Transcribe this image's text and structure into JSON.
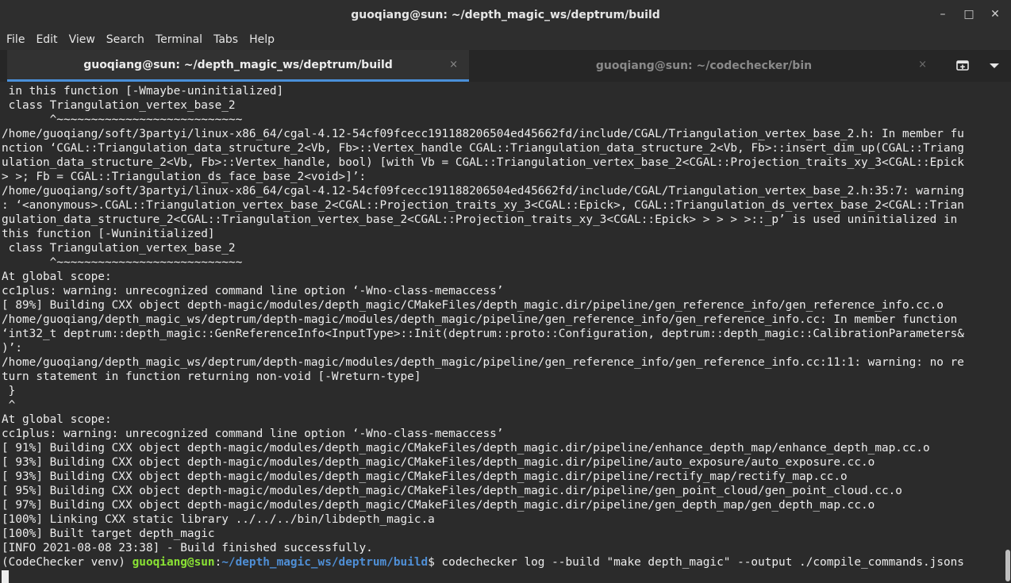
{
  "window": {
    "title": "guoqiang@sun: ~/depth_magic_ws/deptrum/build",
    "minimize": "–",
    "maximize": "□",
    "close": "✕"
  },
  "menu": [
    "File",
    "Edit",
    "View",
    "Search",
    "Terminal",
    "Tabs",
    "Help"
  ],
  "tabs": [
    {
      "label": "guoqiang@sun: ~/depth_magic_ws/deptrum/build",
      "close": "×",
      "active": true
    },
    {
      "label": "guoqiang@sun: ~/codechecker/bin",
      "close": "×",
      "active": false
    }
  ],
  "terminal": {
    "lines": [
      " in this function [-Wmaybe-uninitialized]",
      " class Triangulation_vertex_base_2",
      "       ^~~~~~~~~~~~~~~~~~~~~~~~~~~~",
      "/home/guoqiang/soft/3partyi/linux-x86_64/cgal-4.12-54cf09fcecc191188206504ed45662fd/include/CGAL/Triangulation_vertex_base_2.h: In member fu",
      "nction ‘CGAL::Triangulation_data_structure_2<Vb, Fb>::Vertex_handle CGAL::Triangulation_data_structure_2<Vb, Fb>::insert_dim_up(CGAL::Triang",
      "ulation_data_structure_2<Vb, Fb>::Vertex_handle, bool) [with Vb = CGAL::Triangulation_vertex_base_2<CGAL::Projection_traits_xy_3<CGAL::Epick",
      "> >; Fb = CGAL::Triangulation_ds_face_base_2<void>]’:",
      "/home/guoqiang/soft/3partyi/linux-x86_64/cgal-4.12-54cf09fcecc191188206504ed45662fd/include/CGAL/Triangulation_vertex_base_2.h:35:7: warning",
      ": ‘<anonymous>.CGAL::Triangulation_vertex_base_2<CGAL::Projection_traits_xy_3<CGAL::Epick>, CGAL::Triangulation_ds_vertex_base_2<CGAL::Trian",
      "gulation_data_structure_2<CGAL::Triangulation_vertex_base_2<CGAL::Projection_traits_xy_3<CGAL::Epick> > > > >::_p’ is used uninitialized in",
      "this function [-Wuninitialized]",
      " class Triangulation_vertex_base_2",
      "       ^~~~~~~~~~~~~~~~~~~~~~~~~~~~",
      "At global scope:",
      "cc1plus: warning: unrecognized command line option ‘-Wno-class-memaccess’",
      "[ 89%] Building CXX object depth-magic/modules/depth_magic/CMakeFiles/depth_magic.dir/pipeline/gen_reference_info/gen_reference_info.cc.o",
      "/home/guoqiang/depth_magic_ws/deptrum/depth-magic/modules/depth_magic/pipeline/gen_reference_info/gen_reference_info.cc: In member function",
      "‘int32_t deptrum::depth_magic::GenReferenceInfo<InputType>::Init(deptrum::proto::Configuration, deptrum::depth_magic::CalibrationParameters&",
      ")’:",
      "/home/guoqiang/depth_magic_ws/deptrum/depth-magic/modules/depth_magic/pipeline/gen_reference_info/gen_reference_info.cc:11:1: warning: no re",
      "turn statement in function returning non-void [-Wreturn-type]",
      " }",
      " ^",
      "At global scope:",
      "cc1plus: warning: unrecognized command line option ‘-Wno-class-memaccess’",
      "[ 91%] Building CXX object depth-magic/modules/depth_magic/CMakeFiles/depth_magic.dir/pipeline/enhance_depth_map/enhance_depth_map.cc.o",
      "[ 93%] Building CXX object depth-magic/modules/depth_magic/CMakeFiles/depth_magic.dir/pipeline/auto_exposure/auto_exposure.cc.o",
      "[ 93%] Building CXX object depth-magic/modules/depth_magic/CMakeFiles/depth_magic.dir/pipeline/rectify_map/rectify_map.cc.o",
      "[ 95%] Building CXX object depth-magic/modules/depth_magic/CMakeFiles/depth_magic.dir/pipeline/gen_point_cloud/gen_point_cloud.cc.o",
      "[ 97%] Building CXX object depth-magic/modules/depth_magic/CMakeFiles/depth_magic.dir/pipeline/gen_depth_map/gen_depth_map.cc.o",
      "[100%] Linking CXX static library ../../../bin/libdepth_magic.a",
      "[100%] Built target depth_magic",
      "[INFO 2021-08-08 23:38] - Build finished successfully."
    ],
    "prompt": {
      "venv": "(CodeChecker venv) ",
      "user": "guoqiang@sun",
      "sep": ":",
      "path": "~/depth_magic_ws/deptrum/build",
      "dollar": "$ ",
      "command": "codechecker log --build \"make depth_magic\" --output ./compile_commands.jsons"
    }
  },
  "colors": {
    "background": "#2b2b2b",
    "text": "#ececec",
    "prompt_user": "#8ae234",
    "prompt_path": "#4f8fd6",
    "active_tab_underline": "#4a90d9"
  },
  "icons": {
    "new_tab": "new-tab-icon",
    "tab_menu": "chevron-down-icon"
  }
}
